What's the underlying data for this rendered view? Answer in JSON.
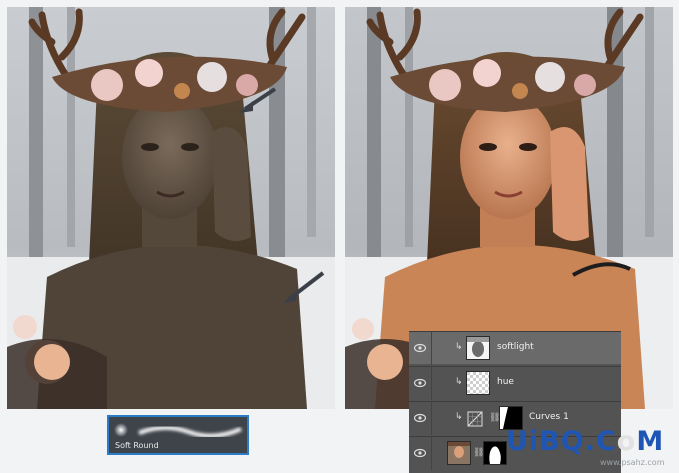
{
  "brush_preview": {
    "label": "Soft Round"
  },
  "layers": [
    {
      "name": "softlight",
      "clipped": true,
      "thumb": "portrait-mask-thumbnail",
      "selected": true
    },
    {
      "name": "hue",
      "clipped": true,
      "thumb": "transparent-checker-thumbnail",
      "selected": false
    },
    {
      "name": "Curves 1",
      "clipped": true,
      "thumb": "curves-adjustment-thumbnail",
      "selected": false
    },
    {
      "name": "",
      "clipped": false,
      "thumb": "portrait-thumbnail",
      "selected": false
    }
  ],
  "watermark": {
    "main_a": "UiBQ.C",
    "main_o": "o",
    "main_b": "M",
    "sub": "www.psahz.com"
  },
  "icons": {
    "visibility": "eye-icon",
    "link": "chain-link-icon",
    "clip": "clipping-arrow-icon"
  },
  "colors": {
    "panel_bg": "#535353",
    "selected_row": "#6a6a6a",
    "brush_border": "#2a7cc9",
    "watermark_blue": "#1f56b4"
  }
}
